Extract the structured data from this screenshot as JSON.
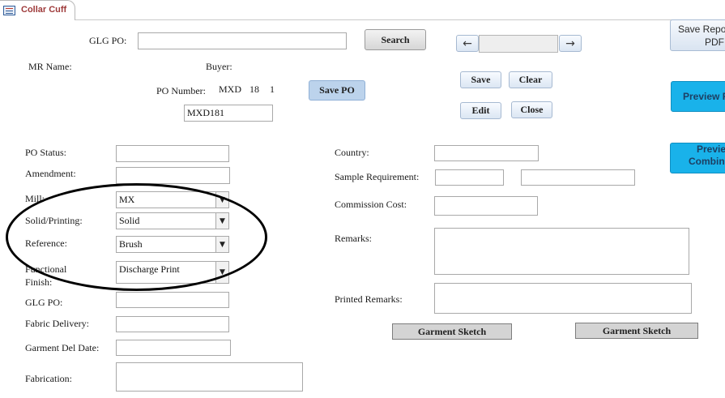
{
  "tab": {
    "title": "Collar Cuff",
    "icon": "form-icon"
  },
  "header": {
    "glg_po_label": "GLG PO:",
    "search_label": "Search",
    "mr_name_label": "MR Name:",
    "buyer_label": "Buyer:",
    "po_number_label": "PO Number:",
    "po_number_parts": [
      "MXD",
      "18",
      "1"
    ],
    "po_number_value": "MXD181",
    "save_po_label": "Save PO"
  },
  "nav": {
    "prev_icon": "arrow-left-icon",
    "next_icon": "arrow-right-icon",
    "prev": "←",
    "next": "→"
  },
  "actions": {
    "save": "Save",
    "clear": "Clear",
    "edit": "Edit",
    "close": "Close"
  },
  "right_buttons": {
    "save_report_line1": "Save Repo",
    "save_report_line2": "PDF",
    "preview_report": "Preview R",
    "preview_combined_line1": "Previe",
    "preview_combined_line2": "Combine"
  },
  "left_fields": {
    "po_status": {
      "label": "PO Status:",
      "value": ""
    },
    "amendment": {
      "label": "Amendment:",
      "value": ""
    },
    "mill": {
      "label": "Mill:",
      "value": "MX"
    },
    "solid_printing": {
      "label": "Solid/Printing:",
      "value": "Solid"
    },
    "reference": {
      "label": "Reference:",
      "value": "Brush"
    },
    "functional_finish": {
      "label_line1": "Functional",
      "label_line2": "Finish:",
      "value": "Discharge Print"
    },
    "glg_po2": {
      "label": "GLG PO:",
      "value": ""
    },
    "fabric_delivery": {
      "label": "Fabric Delivery:",
      "value": ""
    },
    "garment_del_date": {
      "label": "Garment Del Date:",
      "value": ""
    },
    "fabrication": {
      "label": "Fabrication:",
      "value": ""
    }
  },
  "right_fields": {
    "country": {
      "label": "Country:",
      "value": ""
    },
    "sample_requirement": {
      "label": "Sample Requirement:",
      "value1": "",
      "value2": ""
    },
    "commission_cost": {
      "label": "Commission Cost:",
      "value": ""
    },
    "remarks": {
      "label": "Remarks:",
      "value": ""
    },
    "printed_remarks": {
      "label": "Printed Remarks:",
      "value": ""
    }
  },
  "sketch_buttons": {
    "left": "Garment Sketch",
    "right": "Garment Sketch"
  },
  "combo_arrow": "▼",
  "colors": {
    "accent_cyan": "#19b2ea",
    "tab_label": "#9e3a3a",
    "button_blue": "#bcd3ec"
  }
}
